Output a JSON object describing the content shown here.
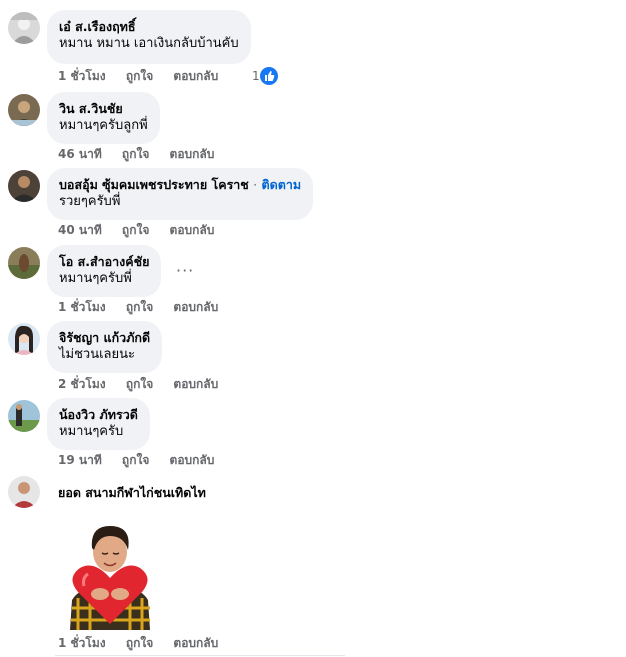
{
  "colors": {
    "bubble": "#f0f2f5",
    "meta_text": "#65676b",
    "follow_link": "#0064d1",
    "like_badge": "#1877f2"
  },
  "comments": [
    {
      "author": "เอ๋ ส.เรืองฤทธิ์",
      "text": "หมาน หมาน เอาเงินกลับบ้านคับ",
      "time": "1 ชั่วโมง",
      "like": "ถูกใจ",
      "reply": "ตอบกลับ",
      "reaction_count": "1",
      "reaction_icon": "thumbs-up-icon"
    },
    {
      "author": "วิน ส.วินชัย",
      "text": "หมานๆครับลูกพี่",
      "time": "46 นาที",
      "like": "ถูกใจ",
      "reply": "ตอบกลับ"
    },
    {
      "author": "บอสอุ้ม ซุ้มคมเพชรประทาย โคราช",
      "separator": "·",
      "follow": "ติดตาม",
      "text": "รวยๆครับพี่",
      "time": "40 นาที",
      "like": "ถูกใจ",
      "reply": "ตอบกลับ"
    },
    {
      "author": "โอ ส.สำอางค์ชัย",
      "text": "หมานๆครับพี่",
      "time": "1 ชั่วโมง",
      "like": "ถูกใจ",
      "reply": "ตอบกลับ",
      "more_icon": "more-options-icon"
    },
    {
      "author": "จิรัชญา แก้วภักดี",
      "text": "ไม่ชวนเลยนะ",
      "time": "2 ชั่วโมง",
      "like": "ถูกใจ",
      "reply": "ตอบกลับ"
    },
    {
      "author": "น้องวิว ภัทรวดี",
      "text": "หมานๆครับ",
      "time": "19 นาที",
      "like": "ถูกใจ",
      "reply": "ตอบกลับ"
    },
    {
      "author": "ยอด สนามกีฬาไก่ชนเทิดไท",
      "sticker": "heart-hug-sticker",
      "time": "1 ชั่วโมง",
      "like": "ถูกใจ",
      "reply": "ตอบกลับ"
    }
  ]
}
